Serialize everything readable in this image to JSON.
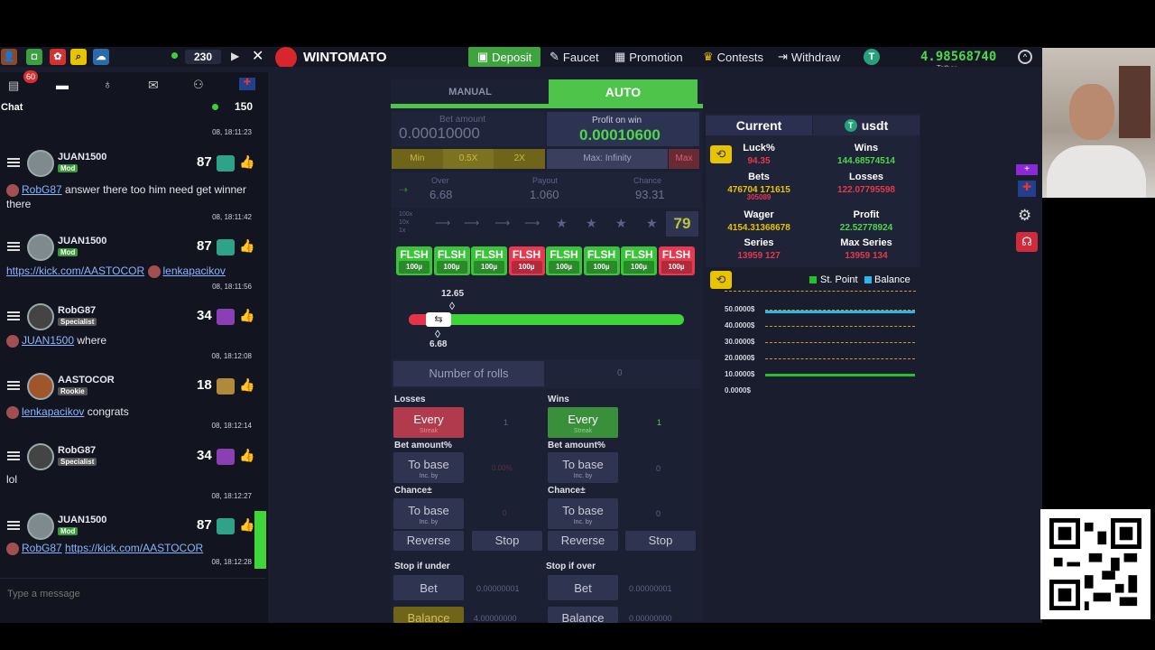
{
  "topbar": {
    "notif_count": "60",
    "online_count": "230",
    "brand": "WINTOMATO",
    "deposit": "Deposit",
    "faucet": "Faucet",
    "promotion": "Promotion",
    "contests": "Contests",
    "withdraw": "Withdraw",
    "balance": "4.98568740",
    "currency_label": "Tether",
    "accent": "#52c24a"
  },
  "chat": {
    "title": "Chat",
    "online": "150",
    "first_time": "08, 18:11:23",
    "placeholder": "Type a message",
    "messages": [
      {
        "user": "JUAN1500",
        "rank": "Mod",
        "level": "87",
        "text_mention": "RobG87",
        "text": "answer there too him need get winner there",
        "time": "08, 18:11:42"
      },
      {
        "user": "JUAN1500",
        "rank": "Mod",
        "level": "87",
        "link": "https://kick.com/AASTOCOR",
        "text_mention": "lenkapacikov",
        "time": "08, 18:11:56"
      },
      {
        "user": "RobG87",
        "rank": "Specialist",
        "level": "34",
        "text_mention": "JUAN1500",
        "text": "where",
        "time": "08, 18:12:08"
      },
      {
        "user": "AASTOCOR",
        "rank": "Rookie",
        "level": "18",
        "text_mention": "lenkapacikov",
        "text": "congrats",
        "time": "08, 18:12:14"
      },
      {
        "user": "RobG87",
        "rank": "Specialist",
        "level": "34",
        "text": "lol",
        "time": "08, 18:12:27"
      },
      {
        "user": "JUAN1500",
        "rank": "Mod",
        "level": "87",
        "text_mention": "RobG87",
        "link": "https://kick.com/AASTOCOR",
        "time": "08, 18:12:28"
      }
    ]
  },
  "game": {
    "tab_manual": "MANUAL",
    "tab_auto": "AUTO",
    "bet_label": "Bet amount",
    "bet_value": "0.00010000",
    "profit_label": "Profit on win",
    "profit_value": "0.00010600",
    "min": "Min",
    "half": "0.5X",
    "double": "2X",
    "max_label": "Max: Infinity",
    "max": "Max",
    "over_label": "Over",
    "over_value": "6.68",
    "payout_label": "Payout",
    "payout_value": "1.060",
    "chance_label": "Chance",
    "chance_value": "93.31",
    "mult_labels": [
      "100x",
      "10x",
      "1x"
    ],
    "star_count": "79",
    "flash_label": "FLSH",
    "flash_sub": "100µ",
    "flashes": [
      "win",
      "win",
      "win",
      "loss",
      "win",
      "win",
      "win",
      "loss"
    ],
    "slider_top": "12.65",
    "slider_bottom": "6.68",
    "rolls_label": "Number of rolls",
    "rolls_value": "0",
    "losses": "Losses",
    "wins": "Wins",
    "every": "Every",
    "streak": "Streak",
    "losses_every_value": "1",
    "wins_every_value": "1",
    "bet_amount_pct": "Bet amount%",
    "to_base": "To base",
    "inc_by": "Inc. by",
    "losses_bet_value": "0.00%",
    "wins_bet_value": "0",
    "chance_pm": "Chance±",
    "losses_chance_value": "0",
    "wins_chance_value": "0",
    "reverse": "Reverse",
    "stop": "Stop",
    "stop_under": "Stop if under",
    "stop_over": "Stop if over",
    "bet_btn": "Bet",
    "under_value": "0.00000001",
    "over_stop_value": "0.00000001",
    "balance_btn": "Balance",
    "balance_under": "4.00000000",
    "balance_over": "0.00000000"
  },
  "stats": {
    "tab_current": "Current",
    "tab_coin": "usdt",
    "luck_label": "Luck%",
    "luck_value": "94.35",
    "wins_label": "Wins",
    "wins_value": "144.68574514",
    "bets_label": "Bets",
    "bets_value": "476704 171615",
    "bets_sub": "305089",
    "losses_label": "Losses",
    "losses_value": "122.07795598",
    "wager_label": "Wager",
    "wager_value": "4154.31368678",
    "profit_label": "Profit",
    "profit_value": "22.52778924",
    "series_label": "Series",
    "series_value": "13959 127",
    "max_series_label": "Max Series",
    "max_series_value": "13959 134",
    "legend_point": "St. Point",
    "legend_balance": "Balance",
    "y_ticks": [
      "50.0000$",
      "40.0000$",
      "30.0000$",
      "20.0000$",
      "10.0000$",
      "0.0000$"
    ]
  },
  "chart_data": {
    "type": "line",
    "series": [
      {
        "name": "St. Point",
        "values": [
          10,
          10
        ]
      },
      {
        "name": "Balance",
        "values": [
          49,
          49
        ]
      }
    ],
    "ylim": [
      0,
      50
    ],
    "colors": {
      "St. Point": "#22c22a",
      "Balance": "#2fb4e6"
    }
  }
}
